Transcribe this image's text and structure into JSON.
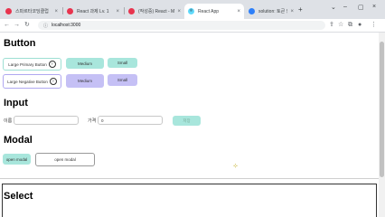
{
  "browser": {
    "tabs": [
      {
        "label": "스파르타코딩클럽",
        "favicon_color": "#e8344e"
      },
      {
        "label": "React 과제 Lv. 1",
        "favicon_color": "#e8344e"
      },
      {
        "label": "(작성중) React - Modal",
        "favicon_color": "#e8344e"
      },
      {
        "label": "React App",
        "favicon_color": "#61dafb"
      },
      {
        "label": "solution: 토큰 인증 + ...",
        "favicon_color": "#2d7ff9"
      }
    ],
    "active_tab_index": 3,
    "new_tab_glyph": "+",
    "url": "localhost:3000"
  },
  "sections": {
    "button": "Button",
    "input": "Input",
    "modal": "Modal",
    "select": "Select"
  },
  "buttons": {
    "large_primary": "Large Primary Button",
    "large_negative": "Large Negative Button",
    "medium_primary": "Medium",
    "small_primary": "Small",
    "medium_negative": "Medium",
    "small_negative": "Small"
  },
  "input": {
    "name_label": "이름",
    "name_value": "",
    "price_label": "가격",
    "price_value": "0",
    "save_button": "저장"
  },
  "modal": {
    "open_small": "open modal",
    "open_large": "open modal"
  },
  "colors": {
    "primary": "#a8e6dc",
    "negative": "#c5c0f5"
  }
}
